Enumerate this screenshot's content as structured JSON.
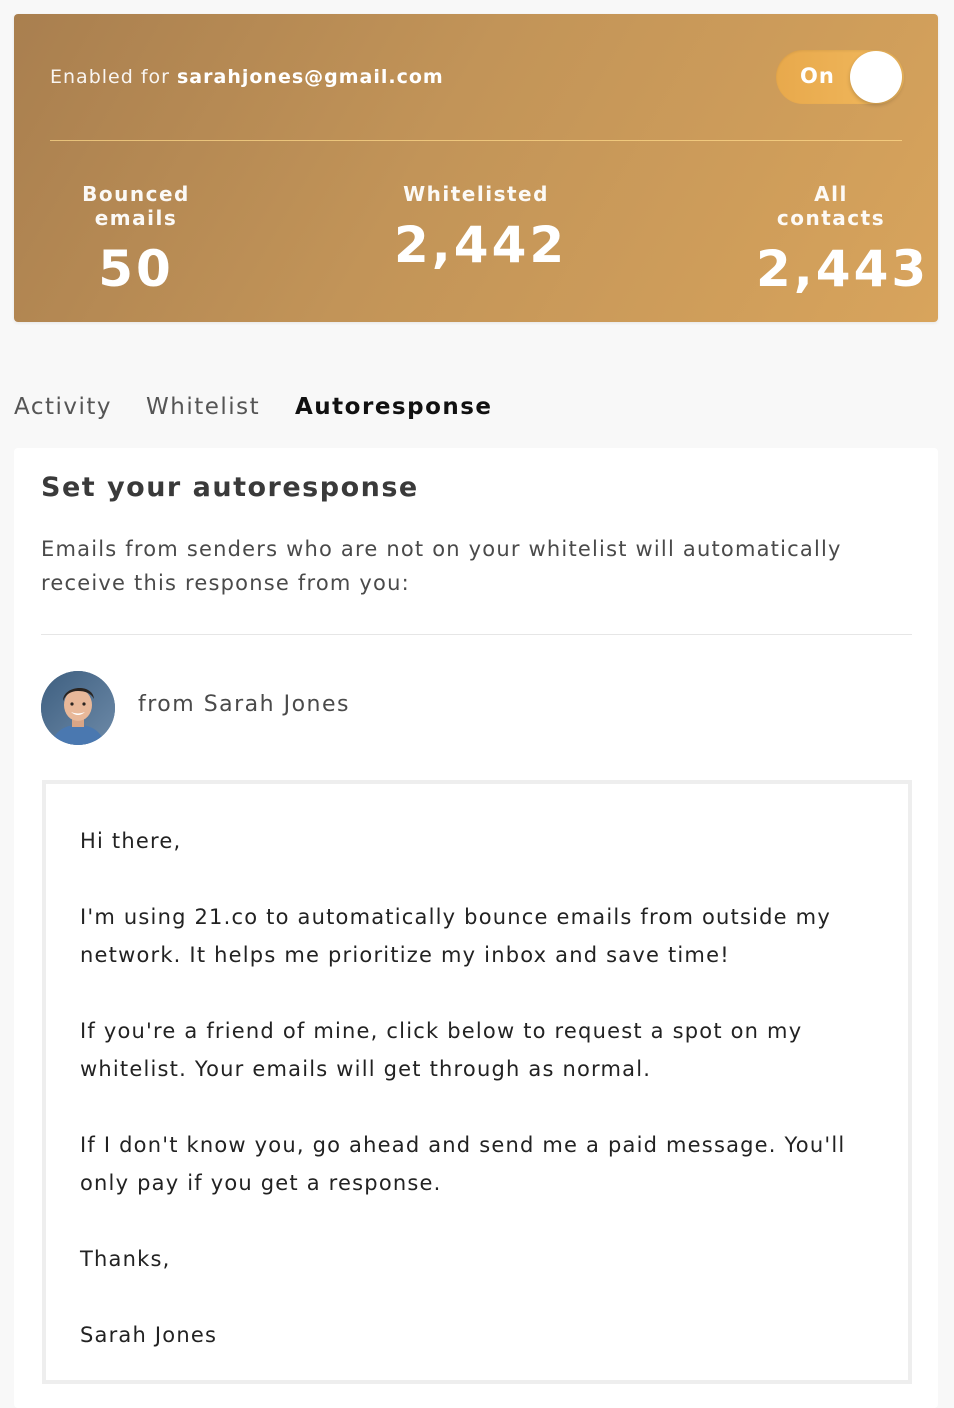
{
  "header": {
    "enabled_prefix": "Enabled for",
    "email": "sarahjones@gmail.com",
    "toggle_label": "On",
    "toggle_state": "on",
    "accent_colors": {
      "gradient_start": "#a97f4f",
      "gradient_end": "#d8a45c",
      "toggle": "#f1b95e"
    }
  },
  "stats": [
    {
      "label": "Bounced emails",
      "value": "50"
    },
    {
      "label": "Whitelisted",
      "value": "2,442"
    },
    {
      "label": "All contacts",
      "value": "2,443"
    }
  ],
  "tabs": [
    {
      "label": "Activity",
      "active": false
    },
    {
      "label": "Whitelist",
      "active": false
    },
    {
      "label": "Autoresponse",
      "active": true
    }
  ],
  "autoresponse": {
    "title": "Set your autoresponse",
    "description": "Emails from senders who are not on your whitelist will automatically receive this response from you:",
    "from_label": "from Sarah Jones",
    "avatar_icon": "user-avatar-photo",
    "message": [
      "Hi there,",
      "I'm using 21.co to automatically bounce emails from outside my network. It helps me prioritize my inbox and save time!",
      "If you're a friend of mine, click below to request a spot on my whitelist. Your emails will get through as normal.",
      "If I don't know you, go ahead and send me a paid message. You'll only pay if you get a response.",
      "Thanks,",
      "Sarah Jones"
    ]
  }
}
